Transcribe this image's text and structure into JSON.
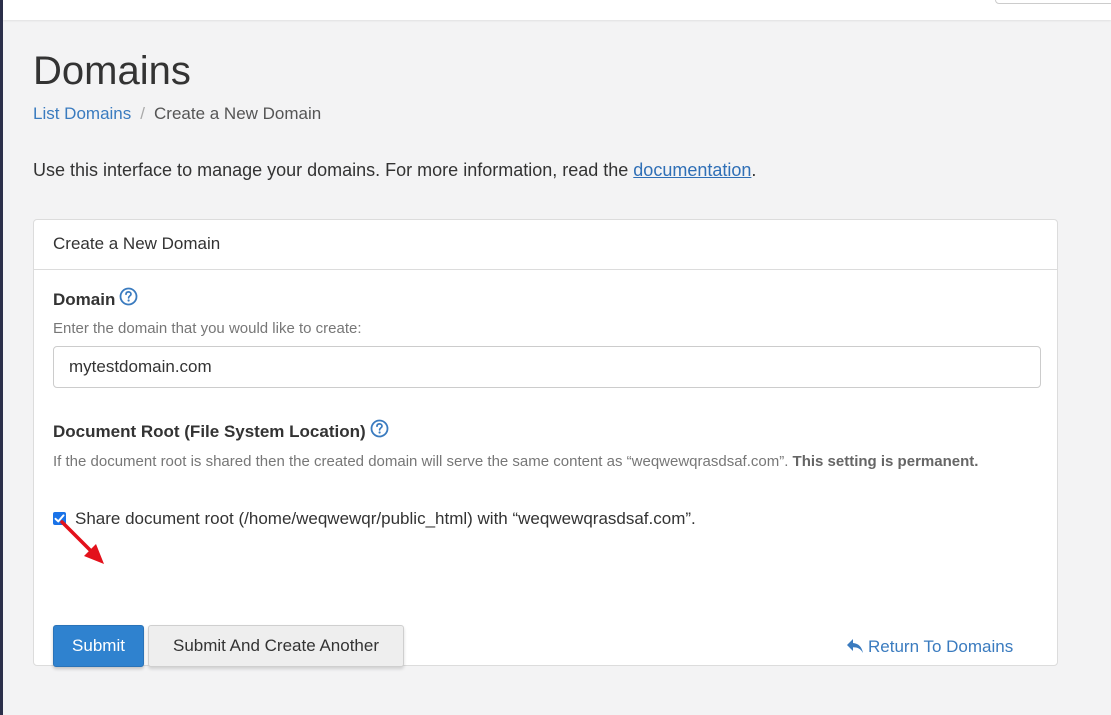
{
  "page": {
    "title": "Domains",
    "breadcrumb": {
      "link": "List Domains",
      "separator": "/",
      "current": "Create a New Domain"
    },
    "intro": {
      "text": "Use this interface to manage your domains. For more information, read the ",
      "link": "documentation",
      "end": "."
    }
  },
  "panel": {
    "header": "Create a New Domain",
    "domain": {
      "label": "Domain",
      "hint": "Enter the domain that you would like to create:",
      "value": "mytestdomain.com"
    },
    "docroot": {
      "label": "Document Root (File System Location)",
      "hint": "If the document root is shared then the created domain will serve the same content as “weqwewqrasdsaf.com”. ",
      "hint_bold": "This setting is permanent.",
      "checkbox_label": "Share document root (/home/weqwewqr/public_html) with “weqwewqrasdsaf.com”.",
      "checked": true
    },
    "buttons": {
      "submit": "Submit",
      "submit_another": "Submit And Create Another",
      "return": "Return To Domains"
    }
  },
  "colors": {
    "link": "#3a7bbf",
    "primary_button": "#2f82cf",
    "annotation_arrow": "#e3111b"
  },
  "icons": {
    "help": "help-circle-icon",
    "return": "reply-arrow-icon",
    "checkbox": "checkmark-icon"
  }
}
